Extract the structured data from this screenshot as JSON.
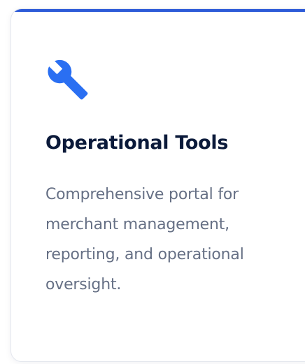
{
  "card": {
    "icon": "wrench-icon",
    "title": "Operational Tools",
    "description": "Comprehensive portal for merchant management, reporting, and operational oversight.",
    "colors": {
      "accent": "#2d5bd8",
      "icon": "#2a6ff2",
      "title": "#0b1a3a",
      "description": "#667085",
      "border": "#e4e7ee"
    }
  }
}
